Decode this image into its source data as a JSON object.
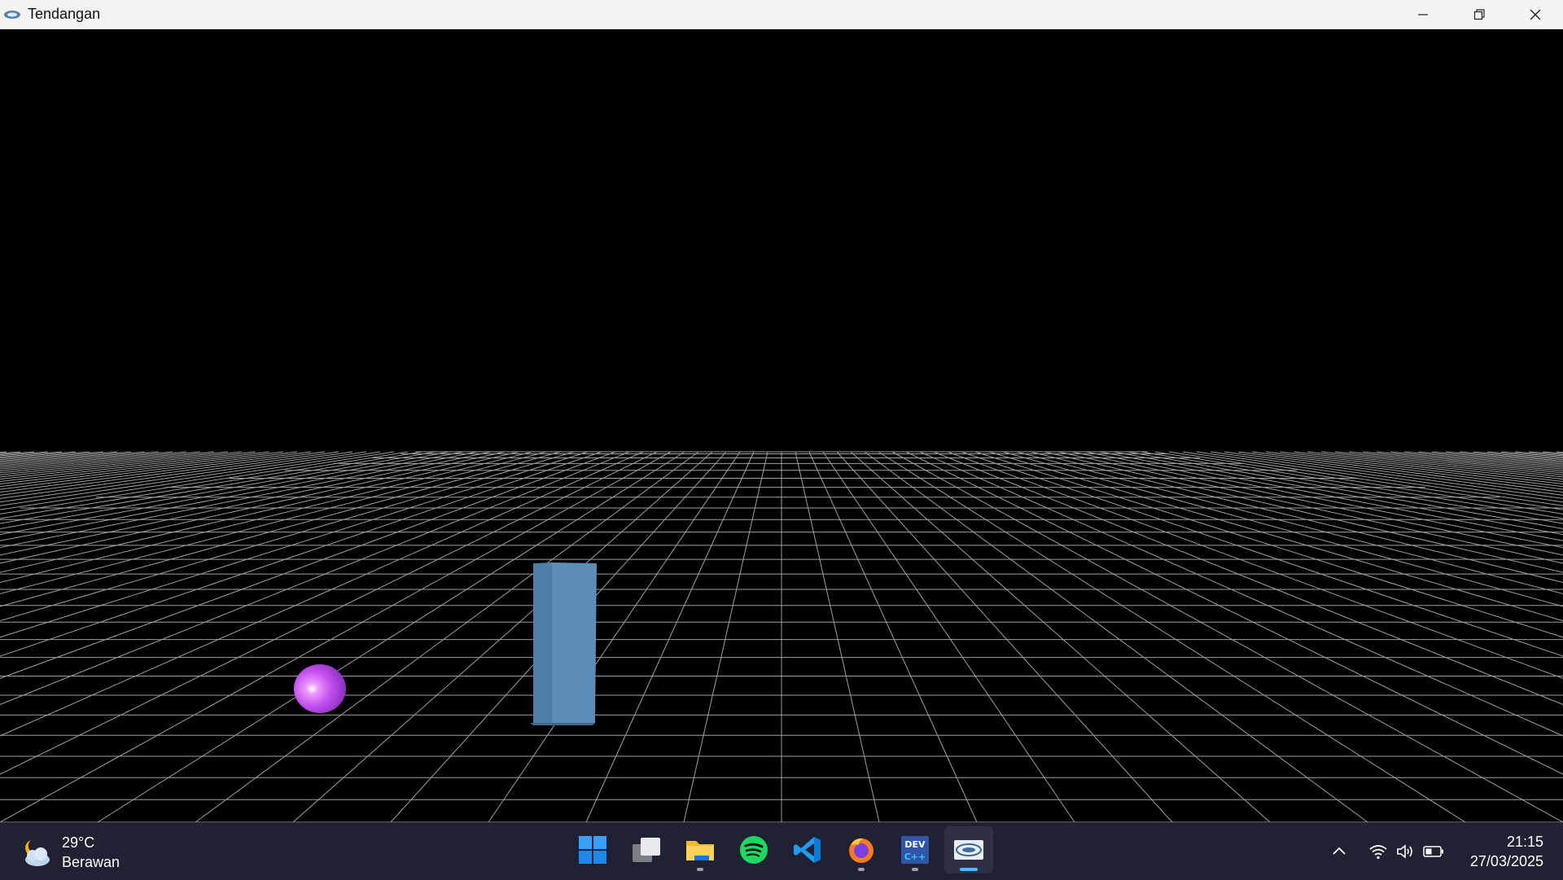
{
  "window": {
    "title": "Tendangan",
    "icon": "opengl-logo-icon",
    "controls": [
      "minimize-icon",
      "restore-icon",
      "close-icon"
    ]
  },
  "scene": {
    "background": "#000000",
    "grid_color": "#bfbfbf",
    "ball_color": "#cc55ee",
    "block_color": "#5c8fb5"
  },
  "taskbar": {
    "weather": {
      "temperature": "29°C",
      "condition": "Berawan",
      "icon": "partly-cloudy-night-icon"
    },
    "apps": [
      {
        "name": "start",
        "icon": "windows-start-icon"
      },
      {
        "name": "task-view",
        "icon": "task-view-icon"
      },
      {
        "name": "file-explorer",
        "icon": "folder-icon"
      },
      {
        "name": "spotify",
        "icon": "spotify-icon"
      },
      {
        "name": "vscode",
        "icon": "vscode-icon"
      },
      {
        "name": "firefox",
        "icon": "firefox-icon"
      },
      {
        "name": "devcpp",
        "icon": "dev-cpp-icon"
      },
      {
        "name": "opengl-app",
        "icon": "opengl-logo-icon"
      }
    ],
    "tray": {
      "icons": [
        "chevron-up-icon",
        "wifi-icon",
        "speaker-icon",
        "battery-icon"
      ]
    },
    "clock": {
      "time": "21:15",
      "date": "27/03/2025"
    }
  }
}
